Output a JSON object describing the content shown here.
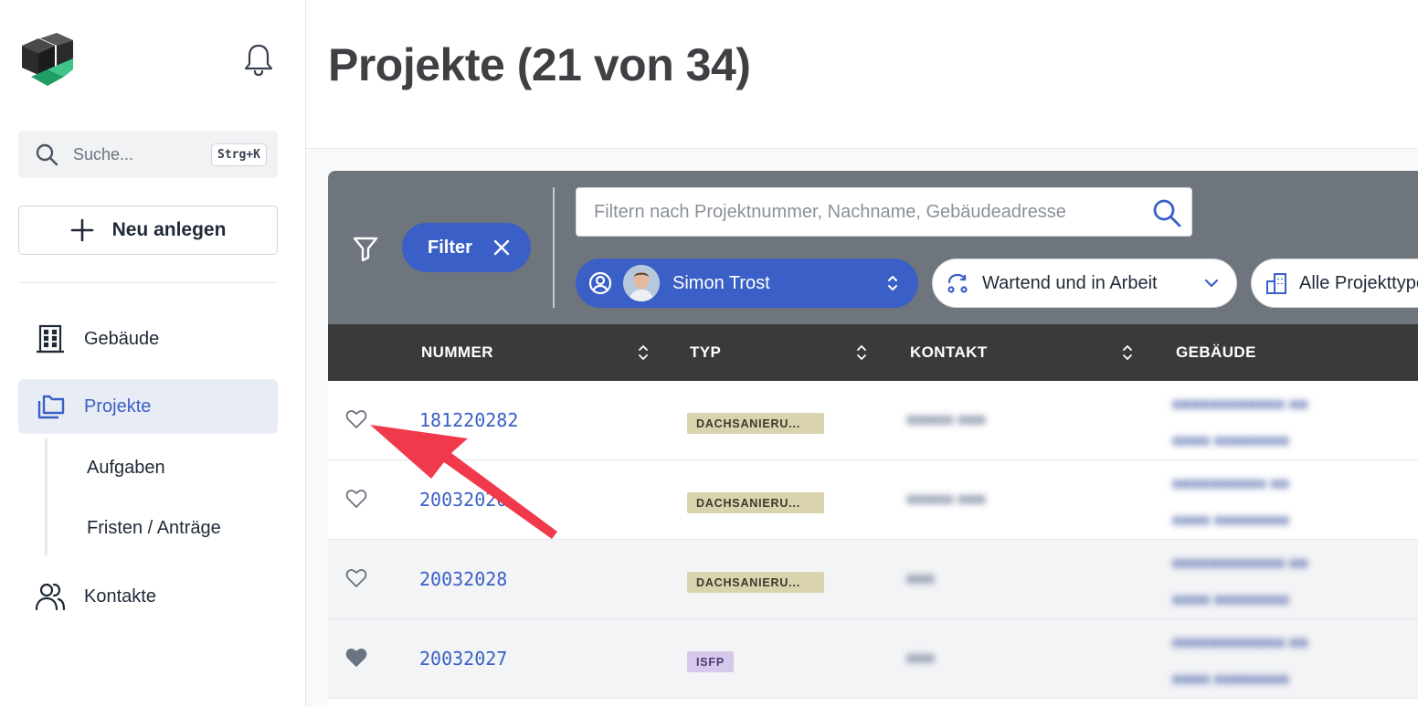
{
  "sidebar": {
    "search": {
      "placeholder": "Suche...",
      "shortcut": "Strg+K"
    },
    "new_button": "Neu anlegen",
    "nav": [
      {
        "label": "Gebäude",
        "icon": "building-icon"
      },
      {
        "label": "Projekte",
        "icon": "folders-icon",
        "active": true
      },
      {
        "label": "Kontakte",
        "icon": "users-icon"
      }
    ],
    "subnav": [
      {
        "label": "Aufgaben"
      },
      {
        "label": "Fristen / Anträge"
      }
    ]
  },
  "main": {
    "title": "Projekte (21 von 34)",
    "toolbar": {
      "filter_label": "Filter",
      "search_placeholder": "Filtern nach Projektnummer, Nachname, Gebäudeadresse",
      "user": "Simon Trost",
      "status": "Wartend und in Arbeit",
      "project_type": "Alle Projekttypen"
    },
    "columns": [
      "NUMMER",
      "TYP",
      "KONTAKT",
      "GEBÄUDE"
    ],
    "rows": [
      {
        "number": "181220282",
        "type": "DACHSANIERU...",
        "favorite": false
      },
      {
        "number": "20032026",
        "type": "DACHSANIERU...",
        "favorite": false
      },
      {
        "number": "20032028",
        "type": "DACHSANIERU...",
        "favorite": false
      },
      {
        "number": "20032027",
        "type": "ISFP",
        "favorite": true
      }
    ]
  },
  "colors": {
    "accent": "#3a5fc6",
    "toolbar_bg": "#6e757c",
    "table_header_bg": "#3a3a3b",
    "annotation_arrow": "#f0394a"
  }
}
